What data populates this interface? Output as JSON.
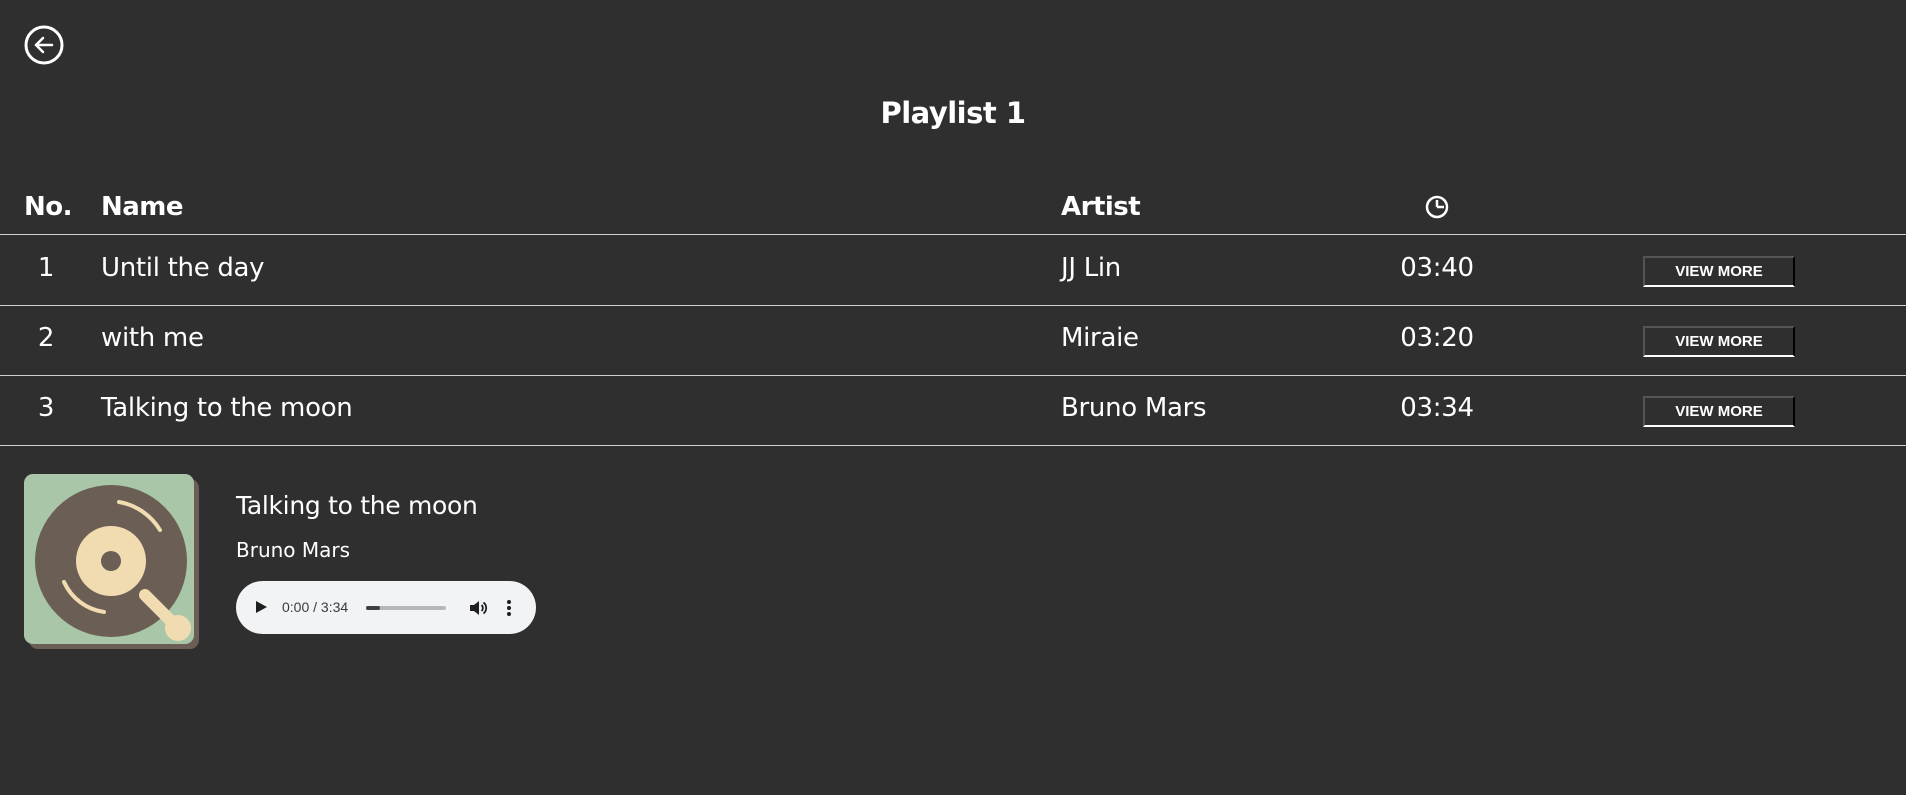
{
  "header": {
    "back_icon": "arrow-left-circle-icon",
    "title": "Playlist 1"
  },
  "table": {
    "columns": {
      "no": "No.",
      "name": "Name",
      "artist": "Artist",
      "duration_icon": "clock-icon"
    },
    "rows": [
      {
        "no": "1",
        "name": "Until the day",
        "artist": "JJ Lin",
        "duration": "03:40",
        "action": "VIEW MORE"
      },
      {
        "no": "2",
        "name": "with me",
        "artist": "Miraie",
        "duration": "03:20",
        "action": "VIEW MORE"
      },
      {
        "no": "3",
        "name": "Talking to the moon",
        "artist": "Bruno Mars",
        "duration": "03:34",
        "action": "VIEW MORE"
      }
    ]
  },
  "now_playing": {
    "album_icon": "record-player-icon",
    "title": "Talking to the moon",
    "artist": "Bruno Mars",
    "player": {
      "time": "0:00 / 3:34",
      "buffered_fraction": 0.18,
      "play_icon": "play-icon",
      "volume_icon": "volume-icon",
      "more_icon": "more-vertical-icon"
    }
  },
  "colors": {
    "background": "#2f2f2f",
    "text": "#ffffff",
    "divider": "#cfcfcf",
    "album_bg": "#a9c6a8",
    "album_shadow": "#6b5f55",
    "record": "#6b5f55",
    "record_label": "#f1dcb2",
    "player_bg": "#f1f3f4"
  }
}
